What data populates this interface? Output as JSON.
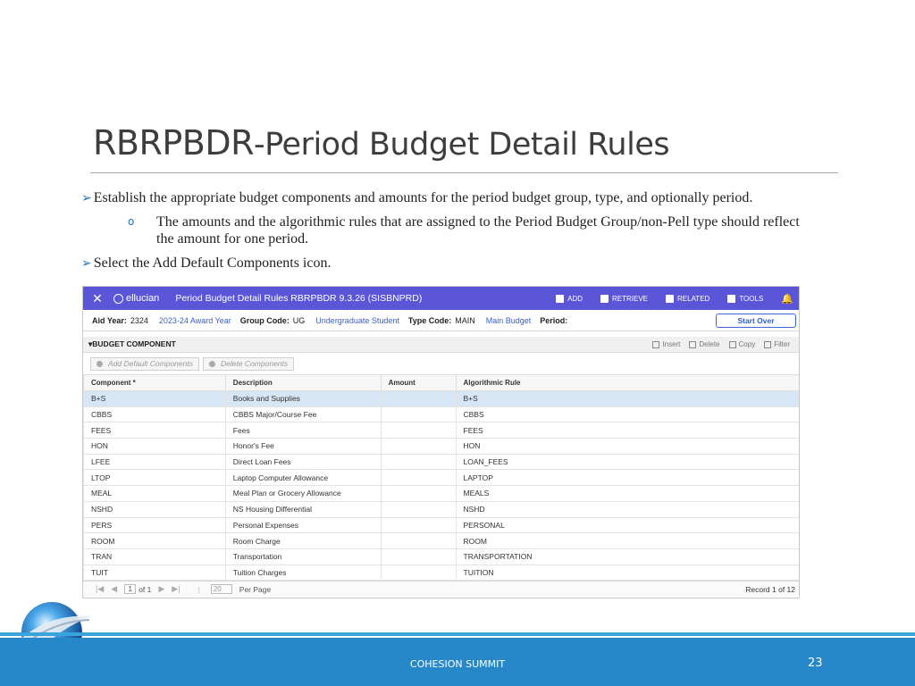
{
  "slide": {
    "title_main": "RBRPBDR",
    "title_rest": "-Period Budget Detail Rules",
    "bullet1": "Establish the appropriate budget components and amounts for the period budget group, type, and optionally period.",
    "bullet2": "The amounts and the algorithmic rules that are assigned to the Period Budget Group/non-Pell type should reflect the amount for one period.",
    "bullet3": "Select the Add Default Components icon.",
    "footer": "COHESION SUMMIT",
    "page_number": "23"
  },
  "app": {
    "brand": "ellucian",
    "window_title": "Period Budget Detail Rules RBRPBDR 9.3.26 (SISBNPRD)",
    "actions": [
      "ADD",
      "RETRIEVE",
      "RELATED",
      "TOOLS"
    ],
    "key": {
      "aid_year_label": "Aid Year:",
      "aid_year_value": "2324",
      "aid_year_desc": "2023-24 Award Year",
      "group_label": "Group Code:",
      "group_value": "UG",
      "group_desc": "Undergraduate Student",
      "type_label": "Type Code:",
      "type_value": "MAIN",
      "type_desc": "Main Budget",
      "period_label": "Period:",
      "start_over": "Start Over"
    },
    "section": {
      "title": "BUDGET COMPONENT",
      "tools": [
        "Insert",
        "Delete",
        "Copy",
        "Filter"
      ],
      "add_default": "Add Default Components",
      "delete_components": "Delete Components"
    },
    "columns": [
      "Component *",
      "Description",
      "Amount",
      "Algorithmic Rule"
    ],
    "rows": [
      [
        "B+S",
        "Books and Supplies",
        "",
        "B+S"
      ],
      [
        "CBBS",
        "CBBS Major/Course Fee",
        "",
        "CBBS"
      ],
      [
        "FEES",
        "Fees",
        "",
        "FEES"
      ],
      [
        "HON",
        "Honor's Fee",
        "",
        "HON"
      ],
      [
        "LFEE",
        "Direct Loan Fees",
        "",
        "LOAN_FEES"
      ],
      [
        "LTOP",
        "Laptop Computer Allowance",
        "",
        "LAPTOP"
      ],
      [
        "MEAL",
        "Meal Plan or Grocery Allowance",
        "",
        "MEALS"
      ],
      [
        "NSHD",
        "NS Housing Differential",
        "",
        "NSHD"
      ],
      [
        "PERS",
        "Personal Expenses",
        "",
        "PERSONAL"
      ],
      [
        "ROOM",
        "Room Charge",
        "",
        "ROOM"
      ],
      [
        "TRAN",
        "Transportation",
        "",
        "TRANSPORTATION"
      ],
      [
        "TUIT",
        "Tuition Charges",
        "",
        "TUITION"
      ]
    ],
    "pager": {
      "page": "1",
      "of": "of 1",
      "per_page_value": "20",
      "per_page_label": "Per Page",
      "record": "Record 1 of 12"
    }
  },
  "colors": {
    "header": "#5b56d8",
    "footer": "#2688c8",
    "selected_row": "#d7e6f5"
  }
}
